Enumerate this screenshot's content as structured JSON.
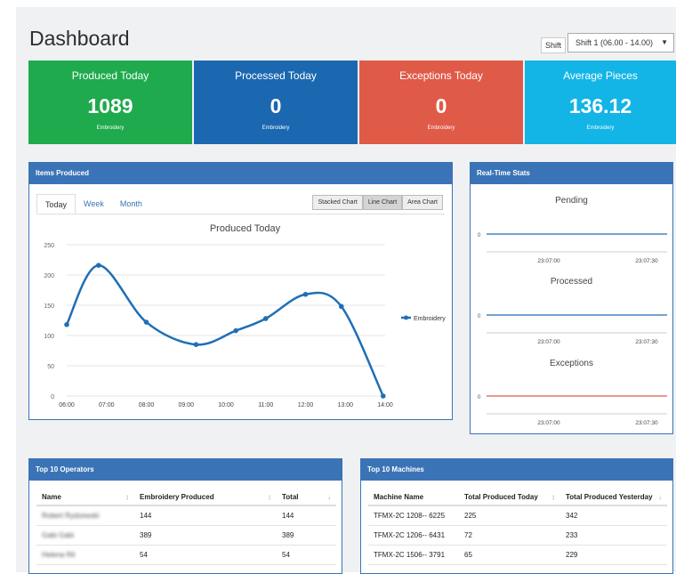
{
  "page": {
    "title": "Dashboard",
    "shift_label": "Shift",
    "shift_value": "Shift 1 (06.00 - 14.00)"
  },
  "cards": [
    {
      "title": "Produced Today",
      "value": "1089",
      "sub": "Embroidery",
      "color": "#1faa4d"
    },
    {
      "title": "Processed Today",
      "value": "0",
      "sub": "Embroidery",
      "color": "#1b68b1"
    },
    {
      "title": "Exceptions Today",
      "value": "0",
      "sub": "Embroidery",
      "color": "#e05a48"
    },
    {
      "title": "Average Pieces",
      "value": "136.12",
      "sub": "Embroidery",
      "color": "#12b5e6"
    }
  ],
  "items_panel": {
    "title": "Items Produced",
    "tabs": [
      "Today",
      "Week",
      "Month"
    ],
    "chart_buttons": [
      "Stacked Chart",
      "Line Chart",
      "Area Chart"
    ]
  },
  "chart_data": {
    "type": "line",
    "title": "Produced Today",
    "x": [
      "06:00",
      "07:00",
      "08:00",
      "09:00",
      "10:00",
      "11:00",
      "12:00",
      "13:00",
      "14:00"
    ],
    "x_values": [
      0,
      0.8,
      2,
      3.25,
      4.25,
      5,
      6,
      6.9,
      7.95
    ],
    "series": [
      {
        "name": "Embroidery",
        "values": [
          118,
          216,
          122,
          85,
          108,
          128,
          168,
          148,
          0
        ],
        "color": "#1f6fb5"
      }
    ],
    "yticks": [
      "0",
      "50",
      "100",
      "150",
      "200",
      "250"
    ],
    "ylim": [
      0,
      250
    ],
    "legend_position": "right"
  },
  "realtime": {
    "title": "Real-Time Stats",
    "charts": [
      {
        "title": "Pending",
        "y": "0",
        "t1": "23:07:00",
        "t2": "23:07:30",
        "color": "#1f6fb5"
      },
      {
        "title": "Processed",
        "y": "0",
        "t1": "23:07:00",
        "t2": "23:07:30",
        "color": "#1f6fb5"
      },
      {
        "title": "Exceptions",
        "y": "0",
        "t1": "23:07:00",
        "t2": "23:07:30",
        "color": "#e05a48"
      }
    ]
  },
  "operators": {
    "title": "Top 10 Operators",
    "headers": [
      "Name",
      "Embroidery Produced",
      "Total"
    ],
    "rows": [
      {
        "name": "Robert Rydzewski",
        "produced": "144",
        "total": "144"
      },
      {
        "name": "Gabi Gabi",
        "produced": "389",
        "total": "389"
      },
      {
        "name": "Helena Rit",
        "produced": "54",
        "total": "54"
      }
    ]
  },
  "machines": {
    "title": "Top 10 Machines",
    "headers": [
      "Machine Name",
      "Total Produced Today",
      "Total Produced Yesterday"
    ],
    "rows": [
      {
        "name": "TFMX-2C 1208-- 6225",
        "today": "225",
        "yesterday": "342"
      },
      {
        "name": "TFMX-2C 1206-- 6431",
        "today": "72",
        "yesterday": "233"
      },
      {
        "name": "TFMX-2C 1506-- 3791",
        "today": "65",
        "yesterday": "229"
      }
    ]
  }
}
